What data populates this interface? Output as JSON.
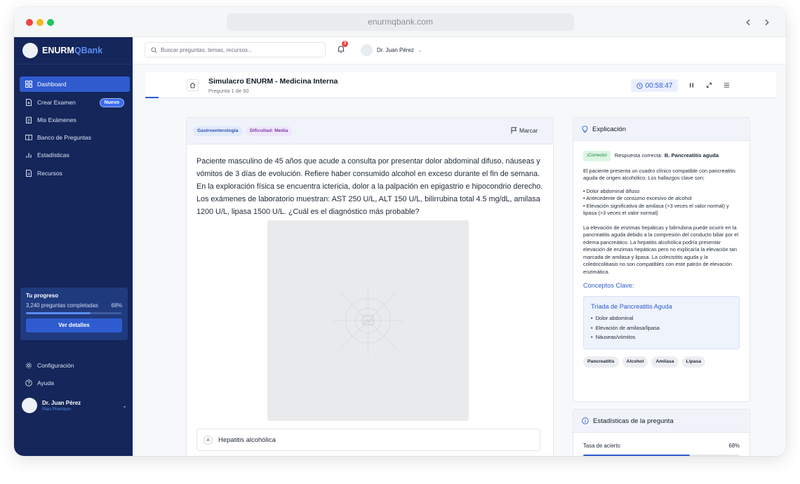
{
  "browser": {
    "url": "enurmqbank.com"
  },
  "brand": {
    "part1": "ENURM",
    "part2": "QBank"
  },
  "sidebar": {
    "items": [
      {
        "label": "Dashboard",
        "icon": "grid-icon",
        "active": true
      },
      {
        "label": "Crear Examen",
        "icon": "document-plus-icon",
        "badge": "Nuevo"
      },
      {
        "label": "Mis Exámenes",
        "icon": "clipboard-icon"
      },
      {
        "label": "Banco de Preguntas",
        "icon": "book-icon"
      },
      {
        "label": "Estadísticas",
        "icon": "bar-chart-icon"
      },
      {
        "label": "Recursos",
        "icon": "file-icon"
      }
    ],
    "progress": {
      "title": "Tu progreso",
      "count_text": "3,240 preguntas completadas",
      "percent_text": "68%",
      "fraction": 0.68,
      "button": "Ver detalles"
    },
    "bottom": [
      {
        "label": "Configuración",
        "icon": "gear-icon"
      },
      {
        "label": "Ayuda",
        "icon": "help-circle-icon"
      }
    ],
    "user": {
      "name": "Dr. Juan Pérez",
      "plan": "Plan Premium"
    }
  },
  "header": {
    "search_placeholder": "Buscar preguntas, temas, recursos...",
    "notifications": "3",
    "user": "Dr. Juan Pérez"
  },
  "exam": {
    "title": "Simulacro ENURM - Medicina Interna",
    "subtitle": "Pregunta 1 de 50",
    "timer": "00:58:47",
    "progress_fraction": 0.02
  },
  "question": {
    "tags": [
      "Gastroenterología",
      "Dificultad: Media"
    ],
    "mark": "Marcar",
    "text": "Paciente masculino de 45 años que acude a consulta por presentar dolor abdominal difuso, náuseas y vómitos de 3 días de evolución. Refiere haber consumido alcohol en exceso durante el fin de semana. En la exploración física se encuentra ictericia, dolor a la palpación en epigastrio e hipocondrio derecho. Los exámenes de laboratorio muestran: AST 250 U/L, ALT 150 U/L, bilirrubina total 4.5 mg/dL, amilasa 1200 U/L, lipasa 1500 U/L. ¿Cuál es el diagnóstico más probable?",
    "options": [
      {
        "letter": "A",
        "text": "Hepatitis alcohólica"
      }
    ]
  },
  "explanation": {
    "title": "Explicación",
    "badge": "¡Correcto!",
    "answer_label": "Respuesta correcta:",
    "answer": "B. Pancreatitis aguda",
    "intro": "El paciente presenta un cuadro clínico compatible con pancreatitis aguda de origen alcohólico. Los hallazgos clave son:",
    "bullets": [
      "• Dolor abdominal difuso",
      "• Antecedente de consumo excesivo de alcohol",
      "• Elevación significativa de amilasa (>3 veces el valor normal) y lipasa (>3 veces el valor normal)"
    ],
    "detail": "La elevación de enzimas hepáticas y bilirrubina puede ocurrir en la pancreatitis aguda debido a la compresión del conducto biliar por el edema pancreático. La hepatitis alcohólica podría presentar elevación de enzimas hepáticas pero no explicaría la elevación tan marcada de amilasa y lipasa. La colecistitis aguda y la coledocolitiasis no son compatibles con este patrón de elevación enzimática.",
    "concepts_title": "Conceptos Clave:",
    "concept_box": {
      "title": "Tríada de Pancreatitis Aguda",
      "items": [
        "Dolor abdominal",
        "Elevación de amilasa/lipasa",
        "Náuseas/vómitos"
      ]
    },
    "chips": [
      "Pancreatitis",
      "Alcohol",
      "Amilasa",
      "Lipasa"
    ]
  },
  "stats": {
    "title": "Estadísticas de la pregunta",
    "label": "Tasa de acierto",
    "value_text": "68%",
    "fraction": 0.68
  },
  "colors": {
    "sidebar": "#14265a",
    "accent": "#2f5bcf",
    "success": "#15803d"
  }
}
